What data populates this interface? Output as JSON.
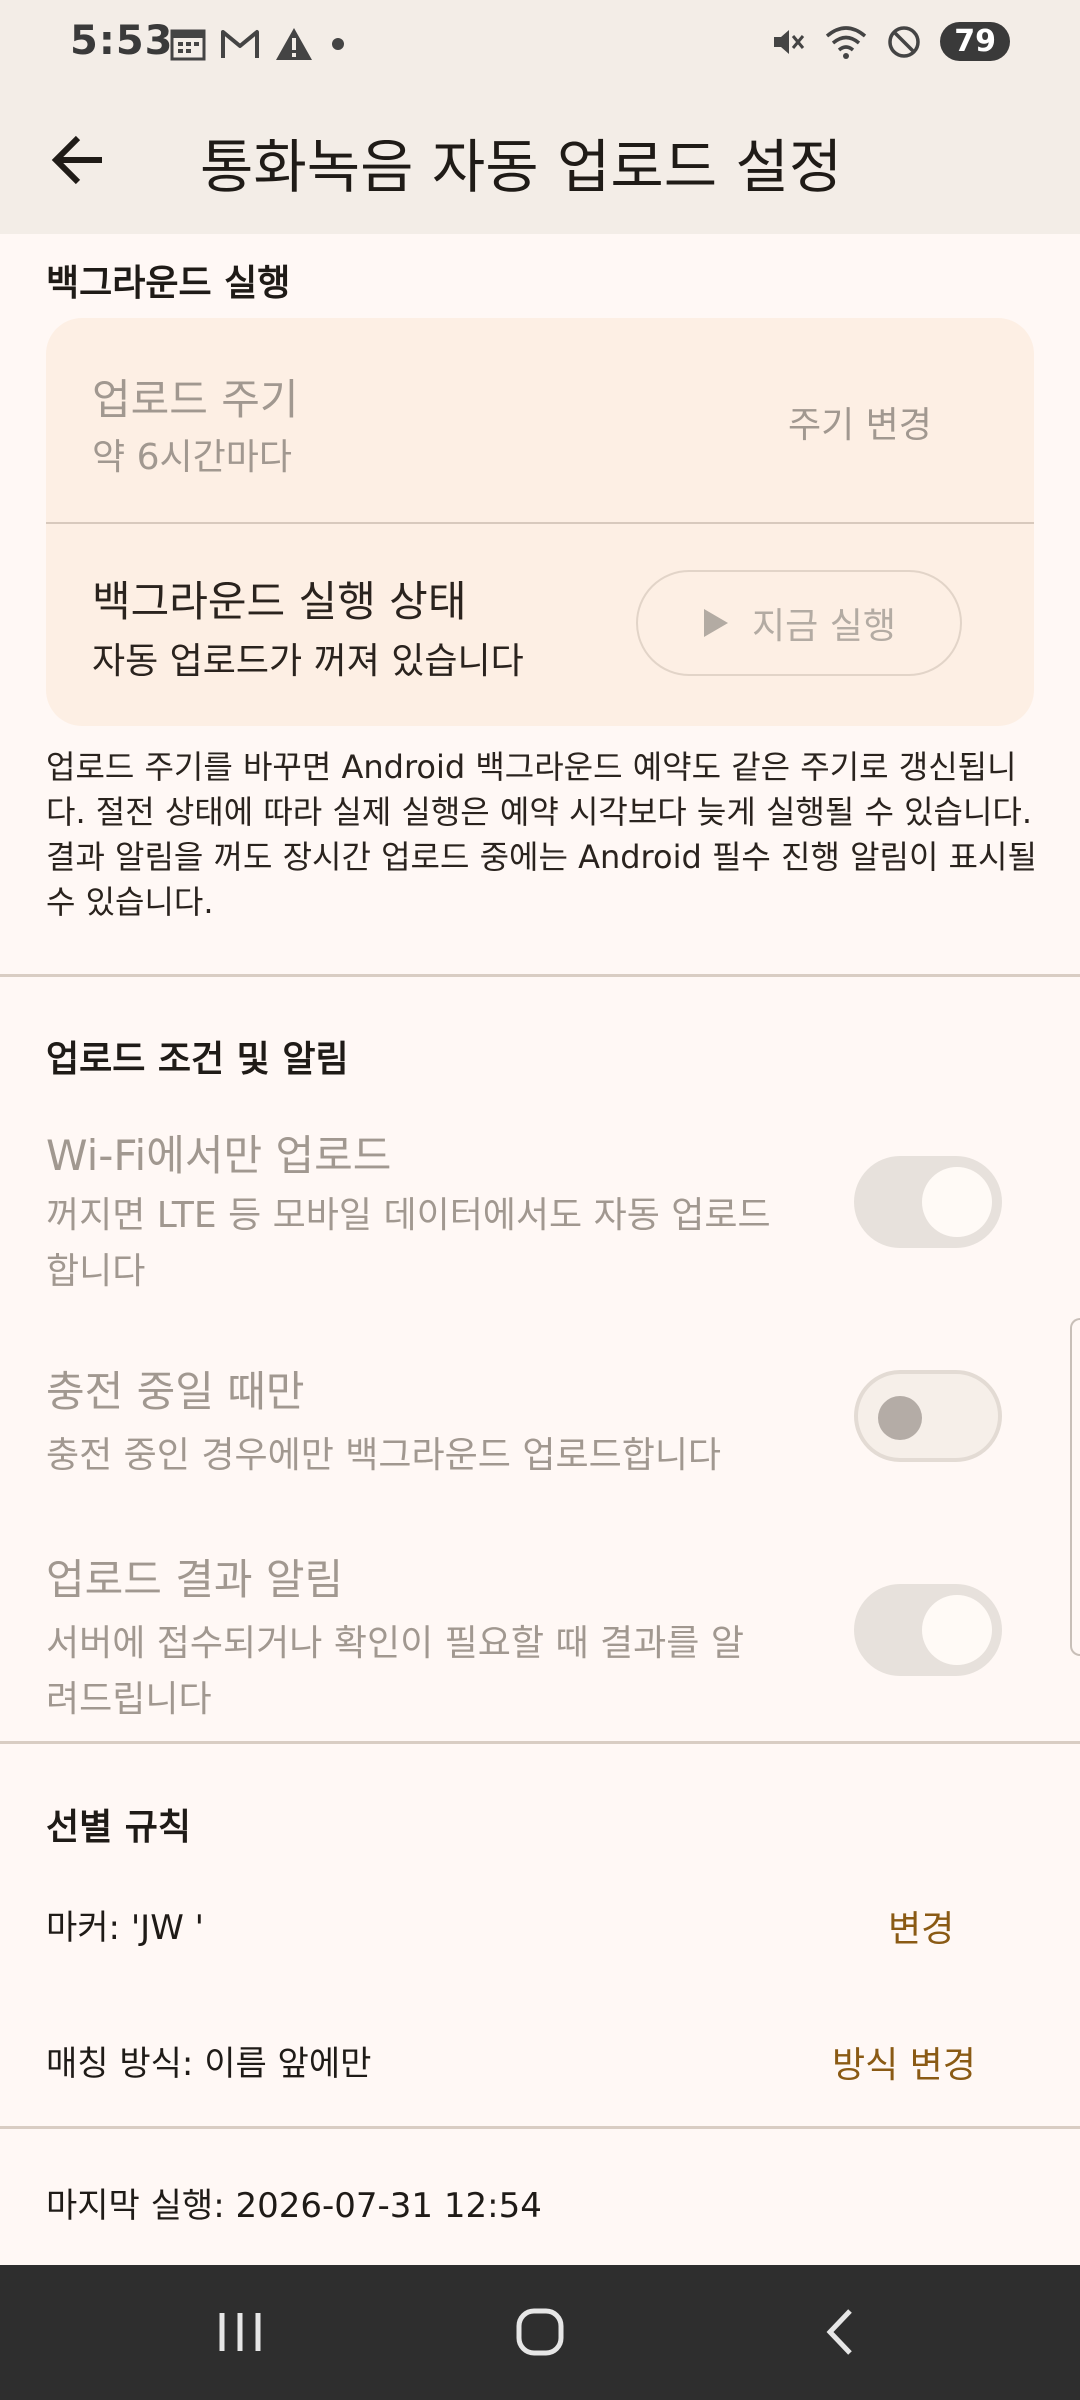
{
  "status_bar": {
    "time": "5:53",
    "left_icons": [
      "calendar-icon",
      "gmail-icon",
      "warning-icon",
      "dot-icon"
    ],
    "right_icons": [
      "mute-vibrate-icon",
      "wifi-icon",
      "do-not-disturb-icon"
    ],
    "battery": "79"
  },
  "app_bar": {
    "title": "통화녹음 자동 업로드 설정",
    "back_icon": "arrow-back-icon"
  },
  "background_section": {
    "header": "백그라운드 실행",
    "upload_period": {
      "title": "업로드 주기",
      "value": "약 6시간마다",
      "action": "주기 변경"
    },
    "run_status": {
      "title": "백그라운드 실행 상태",
      "value": "자동 업로드가 꺼져 있습니다",
      "action": "지금 실행",
      "action_icon": "play-icon"
    },
    "note": "업로드 주기를 바꾸면 Android 백그라운드 예약도 같은 주기로 갱신됩니다. 절전 상태에 따라 실제 실행은 예약 시각보다 늦게 실행될 수 있습니다. 결과 알림을 꺼도 장시간 업로드 중에는 Android 필수 진행 알림이 표시될 수 있습니다."
  },
  "conditions_section": {
    "header": "업로드 조건 및 알림",
    "items": [
      {
        "title": "Wi-Fi에서만 업로드",
        "desc_line1": "꺼지면 LTE 등 모바일 데이터에서도 자동 업로드",
        "desc_line2": "합니다",
        "enabled": true
      },
      {
        "title": "충전 중일 때만",
        "desc_line1": "충전 중인 경우에만 백그라운드 업로드합니다",
        "desc_line2": "",
        "enabled": false
      },
      {
        "title": "업로드 결과 알림",
        "desc_line1": "서버에 접수되거나 확인이 필요할 때 결과를 알",
        "desc_line2": "려드립니다",
        "enabled": true
      }
    ]
  },
  "filter_section": {
    "header": "선별 규칙",
    "marker": {
      "label": "마커: 'JW '",
      "action": "변경"
    },
    "matching": {
      "label": "매칭 방식: 이름 앞에만",
      "action": "방식 변경"
    }
  },
  "last_run": "마지막 실행: 2026-07-31 12:54",
  "nav_bar": {
    "icons": [
      "recent-apps-icon",
      "home-icon",
      "back-nav-icon"
    ]
  },
  "colors": {
    "background": "#fff8f5",
    "app_bar": "#f3ede7",
    "card": "#fdefe4",
    "accent": "#8a5a14",
    "disabled_text": "#a19890",
    "nav_bar": "#2e2e2e"
  }
}
